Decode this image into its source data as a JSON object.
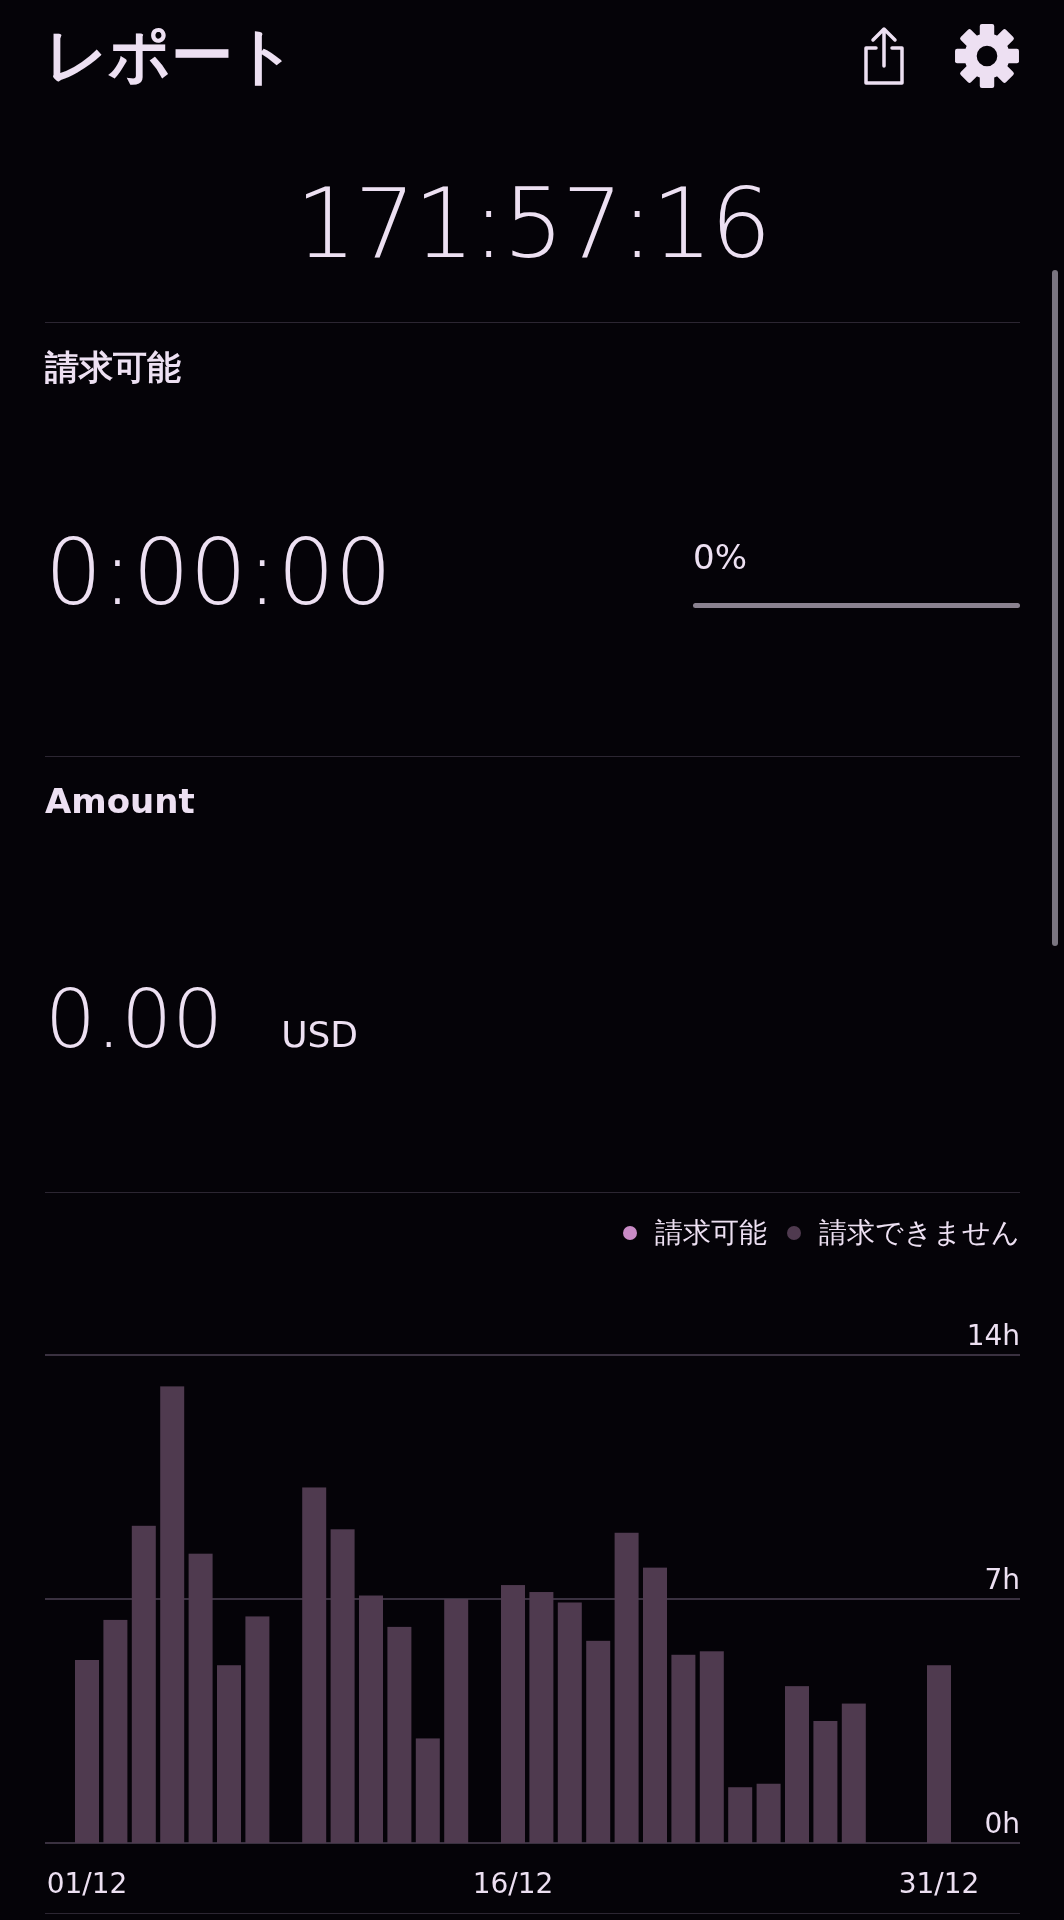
{
  "header": {
    "title": "レポート"
  },
  "total": {
    "value": "171:57:16"
  },
  "billable": {
    "label": "請求可能",
    "value": "0:00:00",
    "percent": "0%",
    "level": 0
  },
  "amount": {
    "label": "Amount",
    "value": "0.00",
    "currency": "USD"
  },
  "chart": {
    "chart_data": {
      "type": "bar",
      "stacked": true,
      "categories": [
        "01/12",
        null,
        null,
        null,
        null,
        null,
        null,
        null,
        null,
        null,
        null,
        null,
        null,
        null,
        null,
        "16/12",
        null,
        null,
        null,
        null,
        null,
        null,
        null,
        null,
        null,
        null,
        null,
        null,
        null,
        null,
        "31/12"
      ],
      "series": [
        {
          "name": "請求可能",
          "color": "#c98bc6",
          "values": [
            0,
            0,
            0,
            0,
            0,
            0,
            0,
            0,
            0,
            0,
            0,
            0,
            0,
            0,
            0,
            0,
            0,
            0,
            0,
            0,
            0,
            0,
            0,
            0,
            0,
            0,
            0,
            0,
            0,
            0,
            0
          ]
        },
        {
          "name": "請求できません",
          "color": "#4f3a4f",
          "values": [
            5.25,
            6.4,
            9.1,
            13.1,
            8.3,
            5.1,
            6.5,
            0,
            10.2,
            9.0,
            7.1,
            6.2,
            3.0,
            7.0,
            0,
            7.4,
            7.2,
            6.9,
            5.8,
            8.9,
            7.9,
            5.4,
            5.5,
            1.6,
            1.7,
            4.5,
            3.5,
            4.0,
            0,
            0,
            5.1
          ]
        }
      ],
      "ylim": [
        0,
        14
      ],
      "yticks": [
        {
          "value": 0,
          "label": "0h"
        },
        {
          "value": 7,
          "label": "7h"
        },
        {
          "value": 14,
          "label": "14h"
        }
      ]
    }
  }
}
